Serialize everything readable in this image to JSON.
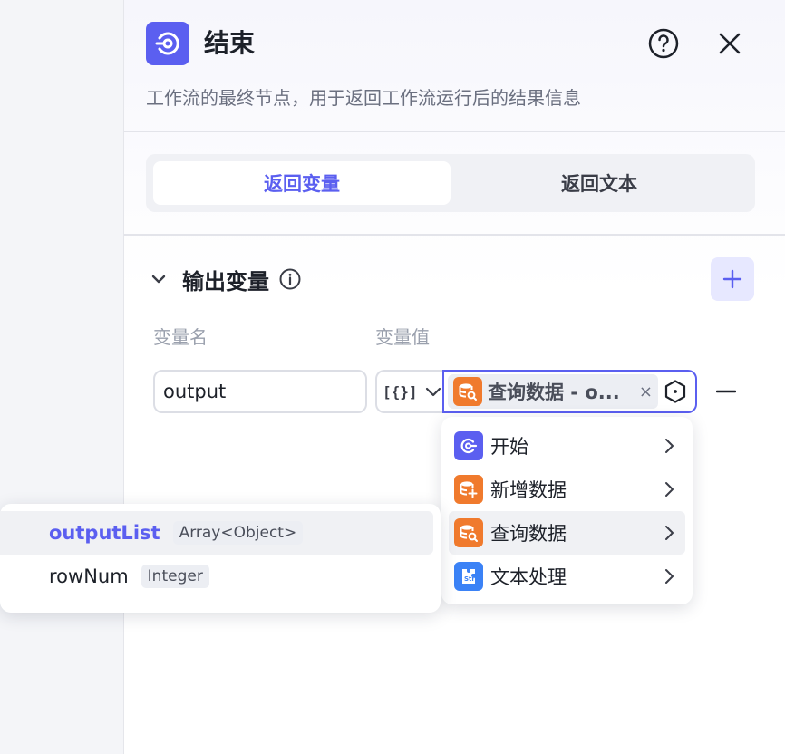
{
  "header": {
    "title": "结束",
    "description": "工作流的最终节点，用于返回工作流运行后的结果信息",
    "icon": "end-node-icon"
  },
  "tabs": [
    {
      "label": "返回变量",
      "active": true
    },
    {
      "label": "返回文本",
      "active": false
    }
  ],
  "output_section": {
    "title": "输出变量",
    "columns": {
      "name": "变量名",
      "value": "变量值"
    },
    "row": {
      "name_value": "output",
      "type_glyph": "[{}]",
      "value_tag": "查询数据 - o...",
      "value_tag_close": "×"
    }
  },
  "menu": {
    "items": [
      {
        "label": "开始",
        "icon": "start-node-icon",
        "color": "#5b5ff0"
      },
      {
        "label": "新增数据",
        "icon": "database-add-icon",
        "color": "#f07a2d"
      },
      {
        "label": "查询数据",
        "icon": "database-search-icon",
        "color": "#f07a2d",
        "hover": true
      },
      {
        "label": "文本处理",
        "icon": "text-process-icon",
        "color": "#3b82f6"
      }
    ]
  },
  "submenu": {
    "items": [
      {
        "name": "outputList",
        "type": "Array<Object>",
        "active": true
      },
      {
        "name": "rowNum",
        "type": "Integer",
        "active": false
      }
    ]
  },
  "colors": {
    "accent": "#5b5ff0",
    "orange": "#f07a2d",
    "blue": "#3b82f6"
  }
}
